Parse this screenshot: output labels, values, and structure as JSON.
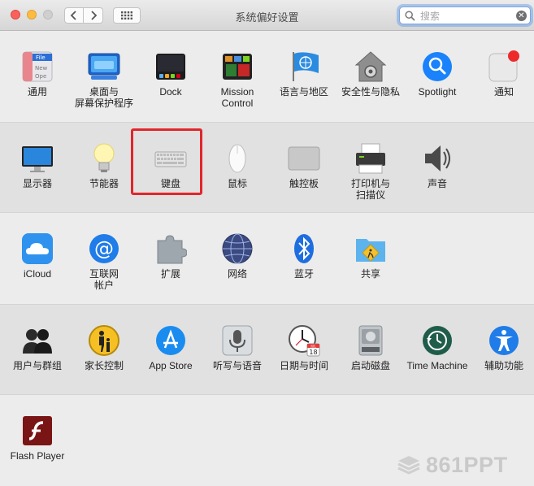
{
  "window": {
    "title": "系统偏好设置",
    "search_placeholder": "搜索"
  },
  "sections": [
    {
      "id": "personal",
      "items": [
        {
          "id": "general",
          "label": "通用",
          "icon": "general-icon"
        },
        {
          "id": "desktop",
          "label": "桌面与\n屏幕保护程序",
          "icon": "desktop-screensaver-icon"
        },
        {
          "id": "dock",
          "label": "Dock",
          "icon": "dock-icon"
        },
        {
          "id": "mission",
          "label": "Mission\nControl",
          "icon": "mission-control-icon"
        },
        {
          "id": "language",
          "label": "语言与地区",
          "icon": "language-region-icon"
        },
        {
          "id": "security",
          "label": "安全性与隐私",
          "icon": "security-privacy-icon"
        },
        {
          "id": "spotlight",
          "label": "Spotlight",
          "icon": "spotlight-icon"
        },
        {
          "id": "notifications",
          "label": "通知",
          "icon": "notifications-icon"
        }
      ]
    },
    {
      "id": "hardware",
      "items": [
        {
          "id": "displays",
          "label": "显示器",
          "icon": "displays-icon"
        },
        {
          "id": "energy",
          "label": "节能器",
          "icon": "energy-saver-icon"
        },
        {
          "id": "keyboard",
          "label": "键盘",
          "icon": "keyboard-icon",
          "highlighted": true
        },
        {
          "id": "mouse",
          "label": "鼠标",
          "icon": "mouse-icon"
        },
        {
          "id": "trackpad",
          "label": "触控板",
          "icon": "trackpad-icon"
        },
        {
          "id": "printers",
          "label": "打印机与\n扫描仪",
          "icon": "printer-scanner-icon"
        },
        {
          "id": "sound",
          "label": "声音",
          "icon": "sound-icon"
        }
      ]
    },
    {
      "id": "internet",
      "items": [
        {
          "id": "icloud",
          "label": "iCloud",
          "icon": "icloud-icon"
        },
        {
          "id": "accounts",
          "label": "互联网\n帐户",
          "icon": "internet-accounts-icon"
        },
        {
          "id": "extensions",
          "label": "扩展",
          "icon": "extensions-icon"
        },
        {
          "id": "network",
          "label": "网络",
          "icon": "network-icon"
        },
        {
          "id": "bluetooth",
          "label": "蓝牙",
          "icon": "bluetooth-icon"
        },
        {
          "id": "sharing",
          "label": "共享",
          "icon": "sharing-icon"
        }
      ]
    },
    {
      "id": "system",
      "items": [
        {
          "id": "users",
          "label": "用户与群组",
          "icon": "users-groups-icon"
        },
        {
          "id": "parental",
          "label": "家长控制",
          "icon": "parental-controls-icon"
        },
        {
          "id": "appstore",
          "label": "App Store",
          "icon": "app-store-icon"
        },
        {
          "id": "dictation",
          "label": "听写与语音",
          "icon": "dictation-speech-icon"
        },
        {
          "id": "datetime",
          "label": "日期与时间",
          "icon": "date-time-icon"
        },
        {
          "id": "startup",
          "label": "启动磁盘",
          "icon": "startup-disk-icon"
        },
        {
          "id": "timemachine",
          "label": "Time Machine",
          "icon": "time-machine-icon"
        },
        {
          "id": "accessibility",
          "label": "辅助功能",
          "icon": "accessibility-icon"
        }
      ]
    },
    {
      "id": "other",
      "items": [
        {
          "id": "flash",
          "label": "Flash Player",
          "icon": "flash-player-icon"
        }
      ]
    }
  ],
  "icon_text": {
    "general": [
      "File",
      "New",
      "Ope"
    ],
    "calendar_month": "JUL",
    "calendar_day": "18"
  },
  "watermark": "861PPT",
  "colors": {
    "highlight": "#e1262b",
    "accent": "#1a82fb"
  }
}
